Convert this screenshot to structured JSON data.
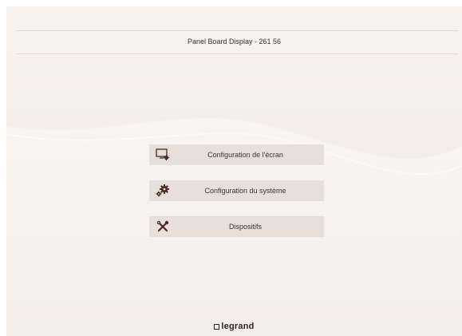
{
  "header": {
    "title": "Panel Board Display - 261 56"
  },
  "menu": {
    "items": [
      {
        "label": "Configuration de l'écran",
        "icon": "screen-settings-icon"
      },
      {
        "label": "Configuration du système",
        "icon": "gears-icon"
      },
      {
        "label": "Dispositifs",
        "icon": "tools-icon"
      }
    ]
  },
  "footer": {
    "brand": "legrand"
  },
  "colors": {
    "background": "#f3eeea",
    "button": "#e7e0da",
    "text": "#3a3330",
    "icon": "#4a2a22"
  }
}
